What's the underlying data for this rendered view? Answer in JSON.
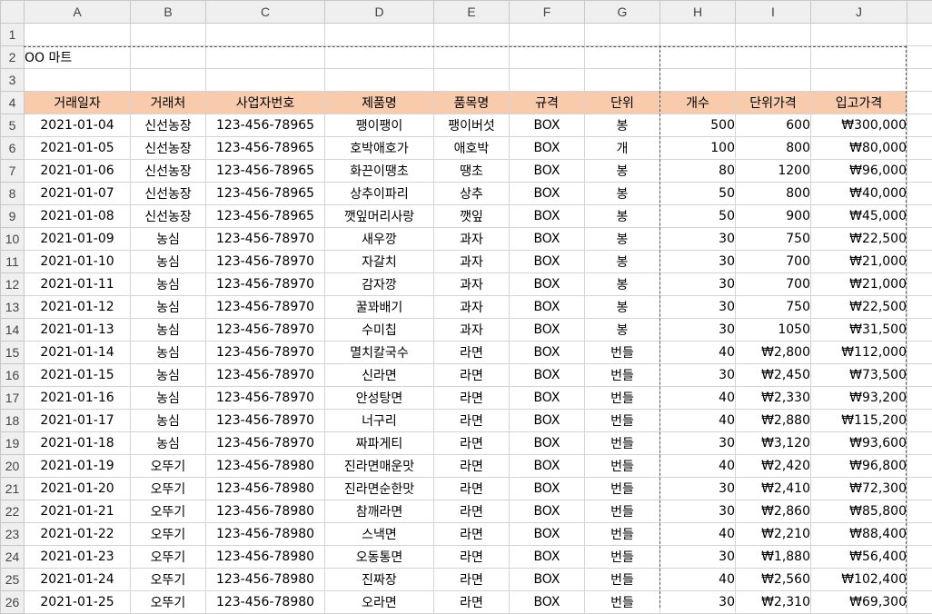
{
  "columns": [
    "A",
    "B",
    "C",
    "D",
    "E",
    "F",
    "G",
    "H",
    "I",
    "J"
  ],
  "title_cell": "OO 마트",
  "headers": [
    "거래일자",
    "거래처",
    "사업자번호",
    "제품명",
    "품목명",
    "규격",
    "단위",
    "개수",
    "단위가격",
    "입고가격"
  ],
  "rows": [
    {
      "num": "5",
      "cells": [
        "2021-01-04",
        "신선농장",
        "123-456-78965",
        "팽이팽이",
        "팽이버섯",
        "BOX",
        "봉",
        "500",
        "600",
        "₩300,000"
      ]
    },
    {
      "num": "6",
      "cells": [
        "2021-01-05",
        "신선농장",
        "123-456-78965",
        "호박애호가",
        "애호박",
        "BOX",
        "개",
        "100",
        "800",
        "₩80,000"
      ]
    },
    {
      "num": "7",
      "cells": [
        "2021-01-06",
        "신선농장",
        "123-456-78965",
        "화끈이땡초",
        "땡초",
        "BOX",
        "봉",
        "80",
        "1200",
        "₩96,000"
      ]
    },
    {
      "num": "8",
      "cells": [
        "2021-01-07",
        "신선농장",
        "123-456-78965",
        "상추이파리",
        "상추",
        "BOX",
        "봉",
        "50",
        "800",
        "₩40,000"
      ]
    },
    {
      "num": "9",
      "cells": [
        "2021-01-08",
        "신선농장",
        "123-456-78965",
        "깻잎머리사랑",
        "깻잎",
        "BOX",
        "봉",
        "50",
        "900",
        "₩45,000"
      ]
    },
    {
      "num": "10",
      "cells": [
        "2021-01-09",
        "농심",
        "123-456-78970",
        "새우깡",
        "과자",
        "BOX",
        "봉",
        "30",
        "750",
        "₩22,500"
      ]
    },
    {
      "num": "11",
      "cells": [
        "2021-01-10",
        "농심",
        "123-456-78970",
        "자갈치",
        "과자",
        "BOX",
        "봉",
        "30",
        "700",
        "₩21,000"
      ]
    },
    {
      "num": "12",
      "cells": [
        "2021-01-11",
        "농심",
        "123-456-78970",
        "감자깡",
        "과자",
        "BOX",
        "봉",
        "30",
        "700",
        "₩21,000"
      ]
    },
    {
      "num": "13",
      "cells": [
        "2021-01-12",
        "농심",
        "123-456-78970",
        "꿀꽈배기",
        "과자",
        "BOX",
        "봉",
        "30",
        "750",
        "₩22,500"
      ]
    },
    {
      "num": "14",
      "cells": [
        "2021-01-13",
        "농심",
        "123-456-78970",
        "수미칩",
        "과자",
        "BOX",
        "봉",
        "30",
        "1050",
        "₩31,500"
      ]
    },
    {
      "num": "15",
      "cells": [
        "2021-01-14",
        "농심",
        "123-456-78970",
        "멸치칼국수",
        "라면",
        "BOX",
        "번들",
        "40",
        "₩2,800",
        "₩112,000"
      ]
    },
    {
      "num": "16",
      "cells": [
        "2021-01-15",
        "농심",
        "123-456-78970",
        "신라면",
        "라면",
        "BOX",
        "번들",
        "30",
        "₩2,450",
        "₩73,500"
      ]
    },
    {
      "num": "17",
      "cells": [
        "2021-01-16",
        "농심",
        "123-456-78970",
        "안성탕면",
        "라면",
        "BOX",
        "번들",
        "40",
        "₩2,330",
        "₩93,200"
      ]
    },
    {
      "num": "18",
      "cells": [
        "2021-01-17",
        "농심",
        "123-456-78970",
        "너구리",
        "라면",
        "BOX",
        "번들",
        "40",
        "₩2,880",
        "₩115,200"
      ]
    },
    {
      "num": "19",
      "cells": [
        "2021-01-18",
        "농심",
        "123-456-78970",
        "짜파게티",
        "라면",
        "BOX",
        "번들",
        "30",
        "₩3,120",
        "₩93,600"
      ]
    },
    {
      "num": "20",
      "cells": [
        "2021-01-19",
        "오뚜기",
        "123-456-78980",
        "진라면매운맛",
        "라면",
        "BOX",
        "번들",
        "40",
        "₩2,420",
        "₩96,800"
      ]
    },
    {
      "num": "21",
      "cells": [
        "2021-01-20",
        "오뚜기",
        "123-456-78980",
        "진라면순한맛",
        "라면",
        "BOX",
        "번들",
        "30",
        "₩2,410",
        "₩72,300"
      ]
    },
    {
      "num": "22",
      "cells": [
        "2021-01-21",
        "오뚜기",
        "123-456-78980",
        "참깨라면",
        "라면",
        "BOX",
        "번들",
        "30",
        "₩2,860",
        "₩85,800"
      ]
    },
    {
      "num": "23",
      "cells": [
        "2021-01-22",
        "오뚜기",
        "123-456-78980",
        "스낵면",
        "라면",
        "BOX",
        "번들",
        "40",
        "₩2,210",
        "₩88,400"
      ]
    },
    {
      "num": "24",
      "cells": [
        "2021-01-23",
        "오뚜기",
        "123-456-78980",
        "오동통면",
        "라면",
        "BOX",
        "번들",
        "30",
        "₩1,880",
        "₩56,400"
      ]
    },
    {
      "num": "25",
      "cells": [
        "2021-01-24",
        "오뚜기",
        "123-456-78980",
        "진짜장",
        "라면",
        "BOX",
        "번들",
        "40",
        "₩2,560",
        "₩102,400"
      ]
    },
    {
      "num": "26",
      "cells": [
        "2021-01-25",
        "오뚜기",
        "123-456-78980",
        "오라면",
        "라면",
        "BOX",
        "번들",
        "30",
        "₩2,310",
        "₩69,300"
      ]
    }
  ],
  "colors": {
    "header_fill": "#f8cbad",
    "row_header_bg": "#efefef",
    "grid": "#d4d4d4"
  }
}
